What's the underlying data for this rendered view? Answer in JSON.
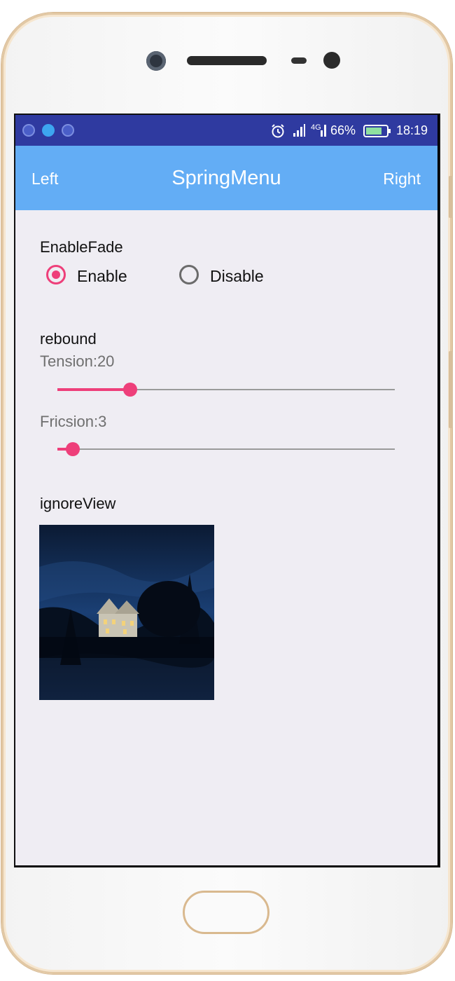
{
  "status_bar": {
    "battery": "66%",
    "time": "18:19",
    "network": "4G"
  },
  "app_bar": {
    "left": "Left",
    "title": "SpringMenu",
    "right": "Right"
  },
  "fade": {
    "heading": "EnableFade",
    "enable_label": "Enable",
    "disable_label": "Disable",
    "selected": "Enable"
  },
  "rebound": {
    "heading": "rebound",
    "tension_label": "Tension:20",
    "tension_fraction": 0.2,
    "friction_label": "Fricsion:3",
    "friction_fraction": 0.03
  },
  "ignore": {
    "heading": "ignoreView"
  },
  "colors": {
    "status_bar": "#2f3aa0",
    "app_bar": "#63adf5",
    "accent": "#ee3f7a",
    "background": "#efedf3"
  }
}
